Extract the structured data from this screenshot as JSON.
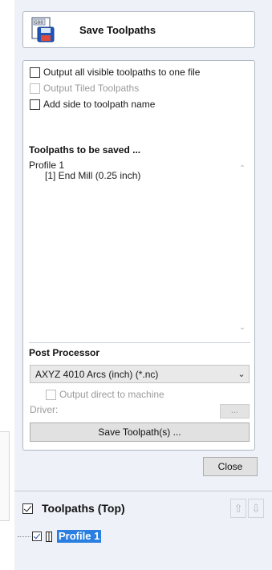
{
  "header": {
    "title": "Save Toolpaths",
    "icon": "save-gcode-icon"
  },
  "options": [
    {
      "label": "Output all visible toolpaths to one file",
      "checked": false,
      "enabled": true
    },
    {
      "label": "Output Tiled Toolpaths",
      "checked": false,
      "enabled": false
    },
    {
      "label": "Add side to toolpath name",
      "checked": false,
      "enabled": true
    }
  ],
  "toolpaths_section": {
    "title": "Toolpaths to be saved ...",
    "items": [
      "Profile 1",
      "[1] End Mill (0.25 inch)"
    ]
  },
  "post_processor": {
    "title": "Post Processor",
    "selected": "AXYZ 4010 Arcs (inch) (*.nc)",
    "output_direct_label": "Output direct to machine",
    "output_direct_checked": false,
    "driver_label": "Driver:",
    "driver_button": "...",
    "save_button": "Save Toolpath(s) ..."
  },
  "close_button": "Close",
  "toolpaths_tree": {
    "title": "Toolpaths (Top)",
    "checked": true,
    "items": [
      {
        "label": "Profile 1",
        "checked": true,
        "selected": true
      }
    ]
  },
  "colors": {
    "selection": "#2b7fe0",
    "panel_bg": "#eef2f8",
    "box_border": "#aeb7c4"
  }
}
